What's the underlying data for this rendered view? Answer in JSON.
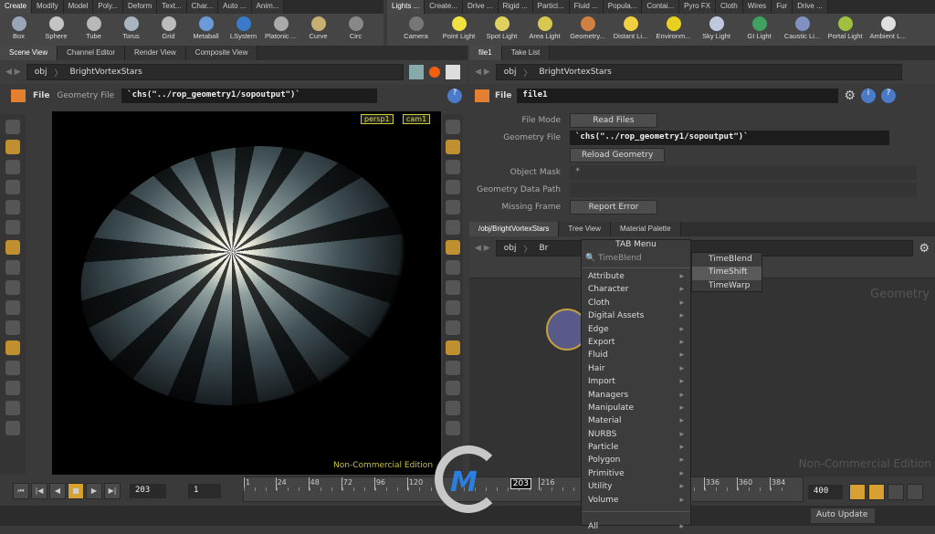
{
  "shelf_left": {
    "tabs": [
      "Create",
      "Modify",
      "Model",
      "Poly...",
      "Deform",
      "Text...",
      "Char...",
      "Auto ...",
      "Anim..."
    ],
    "tools": [
      {
        "label": "Box",
        "color": "#9aa6b8"
      },
      {
        "label": "Sphere",
        "color": "#c4c4c4"
      },
      {
        "label": "Tube",
        "color": "#b8b8b8"
      },
      {
        "label": "Torus",
        "color": "#a8b4c0"
      },
      {
        "label": "Grid",
        "color": "#bbbbbb"
      },
      {
        "label": "Metaball",
        "color": "#6a9ad8"
      },
      {
        "label": "LSystem",
        "color": "#3a7ac8"
      },
      {
        "label": "Platonic ...",
        "color": "#aaaaaa"
      },
      {
        "label": "Curve",
        "color": "#c8b070"
      },
      {
        "label": "Circ",
        "color": "#888888"
      }
    ]
  },
  "shelf_right": {
    "tabs": [
      "Lights ...",
      "Create...",
      "Drive ...",
      "Rigid ...",
      "Particl...",
      "Fluid ...",
      "Popula...",
      "Contai...",
      "Pyro FX",
      "Cloth",
      "Wires",
      "Fur",
      "Drive ..."
    ],
    "tools": [
      {
        "label": "Camera",
        "color": "#777777"
      },
      {
        "label": "Point Light",
        "color": "#f0e040"
      },
      {
        "label": "Spot Light",
        "color": "#e0d060"
      },
      {
        "label": "Area Light",
        "color": "#d8c850"
      },
      {
        "label": "Geometry...",
        "color": "#d08040"
      },
      {
        "label": "Distant Li...",
        "color": "#f0d040"
      },
      {
        "label": "Environm...",
        "color": "#e8d020"
      },
      {
        "label": "Sky Light",
        "color": "#c0c8e0"
      },
      {
        "label": "GI Light",
        "color": "#40a060"
      },
      {
        "label": "Caustic Li...",
        "color": "#8090c0"
      },
      {
        "label": "Portal Light",
        "color": "#a0c040"
      },
      {
        "label": "Ambient L...",
        "color": "#e0e0e0"
      }
    ]
  },
  "scene_pane": {
    "tabs": [
      "Scene View",
      "Channel Editor",
      "Render View",
      "Composite View"
    ],
    "path": [
      "obj",
      "BrightVortexStars"
    ],
    "param_type": "File",
    "param_label": "Geometry File",
    "param_value": "`chs(\"../rop_geometry1/sopoutput\")`",
    "viewport": {
      "camera_menu": "persp1",
      "cam_menu": "cam1",
      "watermark": "Non-Commercial Edition"
    }
  },
  "param_pane": {
    "tabs": [
      "file1",
      "Take List"
    ],
    "path": [
      "obj",
      "BrightVortexStars"
    ],
    "node_type": "File",
    "node_name": "file1",
    "rows": [
      {
        "label": "File Mode",
        "value": "Read Files"
      },
      {
        "label": "Geometry File",
        "value": "`chs(\"../rop_geometry1/sopoutput\")`"
      },
      {
        "label": "",
        "value": "Reload Geometry"
      },
      {
        "label": "Object Mask",
        "value": "*"
      },
      {
        "label": "Geometry Data Path",
        "value": ""
      },
      {
        "label": "Missing Frame",
        "value": "Report Error"
      }
    ]
  },
  "network_pane": {
    "tabs": [
      "/obj/BrightVortexStars",
      "Tree View",
      "Material Palette"
    ],
    "path": [
      "obj",
      "Br"
    ],
    "context_label": "Geometry",
    "watermark": "Non-Commercial Edition"
  },
  "tab_menu": {
    "title": "TAB Menu",
    "search": "TimeBlend",
    "items": [
      "Attribute",
      "Character",
      "Cloth",
      "Digital Assets",
      "Edge",
      "Export",
      "Fluid",
      "Hair",
      "Import",
      "Managers",
      "Manipulate",
      "Material",
      "NURBS",
      "Particle",
      "Polygon",
      "Primitive",
      "Utility",
      "Volume"
    ],
    "all": "All",
    "results": [
      "TimeBlend",
      "TimeShift",
      "TimeWarp"
    ],
    "highlighted": "TimeShift"
  },
  "timeline": {
    "current_frame": "203",
    "start_frame": "1",
    "end_frame": "400",
    "ticks": [
      "1",
      "24",
      "48",
      "72",
      "96",
      "120",
      "216",
      "336",
      "360",
      "384"
    ],
    "marker": "203",
    "range": [
      1,
      400
    ]
  },
  "status": {
    "update_mode": "Auto Update"
  },
  "colors": {
    "accent": "#d8a030",
    "panel": "#3a3a3a",
    "viewport": "#000000"
  }
}
